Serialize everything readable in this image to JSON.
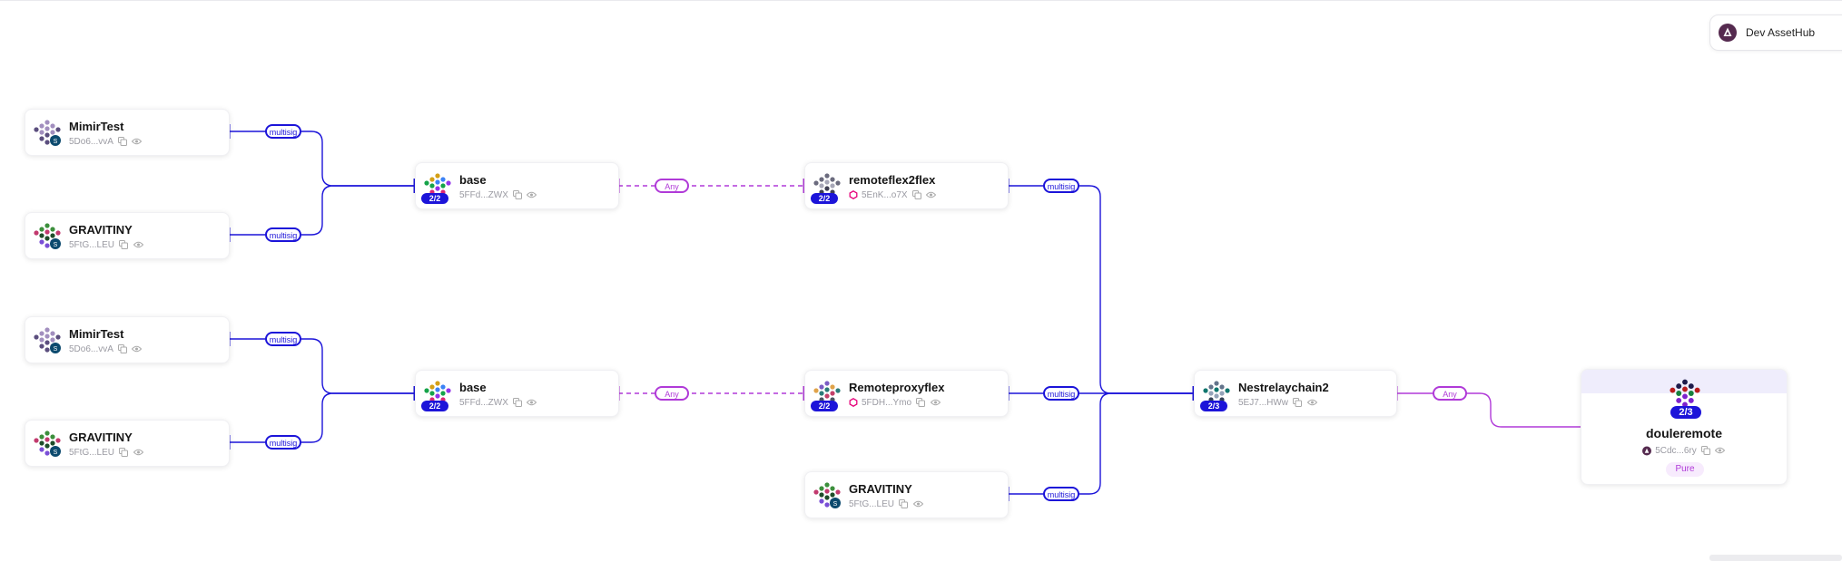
{
  "network": {
    "label": "Dev AssetHub",
    "icon": "assethub-logo-icon"
  },
  "nodes": {
    "mimir1": {
      "name": "MimirTest",
      "address": "5Do6...vvA"
    },
    "grav1": {
      "name": "GRAVITINY",
      "address": "5FtG...LEU"
    },
    "mimir2": {
      "name": "MimirTest",
      "address": "5Do6...vvA"
    },
    "grav2": {
      "name": "GRAVITINY",
      "address": "5FtG...LEU"
    },
    "base1": {
      "name": "base",
      "address": "5FFd...ZWX",
      "threshold": "2/2"
    },
    "base2": {
      "name": "base",
      "address": "5FFd...ZWX",
      "threshold": "2/2"
    },
    "rf2f": {
      "name": "remoteflex2flex",
      "address": "5EnK...o7X",
      "threshold": "2/2"
    },
    "rpf": {
      "name": "Remoteproxyflex",
      "address": "5FDH...Ymo",
      "threshold": "2/2"
    },
    "grav3": {
      "name": "GRAVITINY",
      "address": "5FtG...LEU"
    },
    "nest": {
      "name": "Nestrelaychain2",
      "address": "5EJ7...HWw",
      "threshold": "2/3"
    },
    "doule": {
      "name": "douleremote",
      "address": "5Cdc...6ry",
      "threshold": "2/3",
      "badge": "Pure"
    }
  },
  "edges": {
    "multisig_label": "multisig",
    "any_label": "Any"
  },
  "colors": {
    "multisig": "#1c14d9",
    "proxy": "#b03ad8",
    "pure_header": "#efedfc"
  }
}
